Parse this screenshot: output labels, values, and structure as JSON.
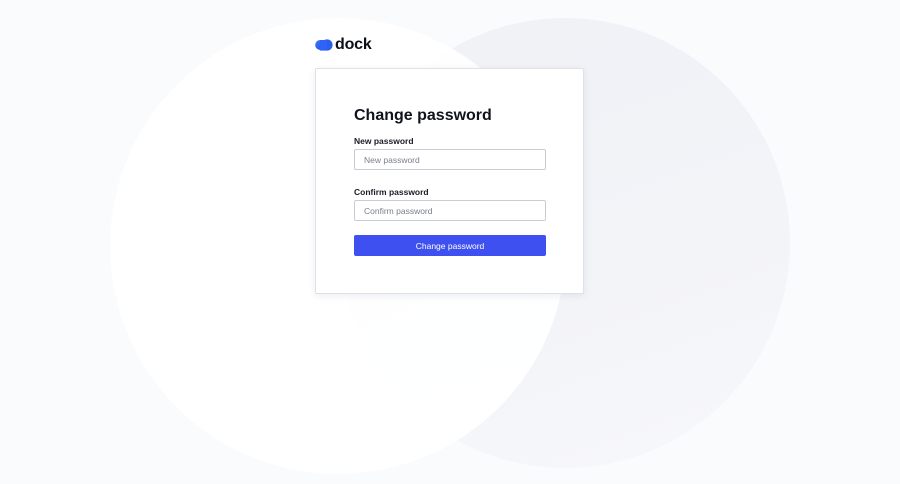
{
  "brand": {
    "name": "dock",
    "logo_icon": "cloud-icon",
    "accent_color": "#3f50f0",
    "logo_color": "#2f63f6"
  },
  "form": {
    "title": "Change password",
    "new_password": {
      "label": "New password",
      "placeholder": "New password",
      "value": ""
    },
    "confirm_password": {
      "label": "Confirm password",
      "placeholder": "Confirm password",
      "value": ""
    },
    "submit_label": "Change password"
  }
}
